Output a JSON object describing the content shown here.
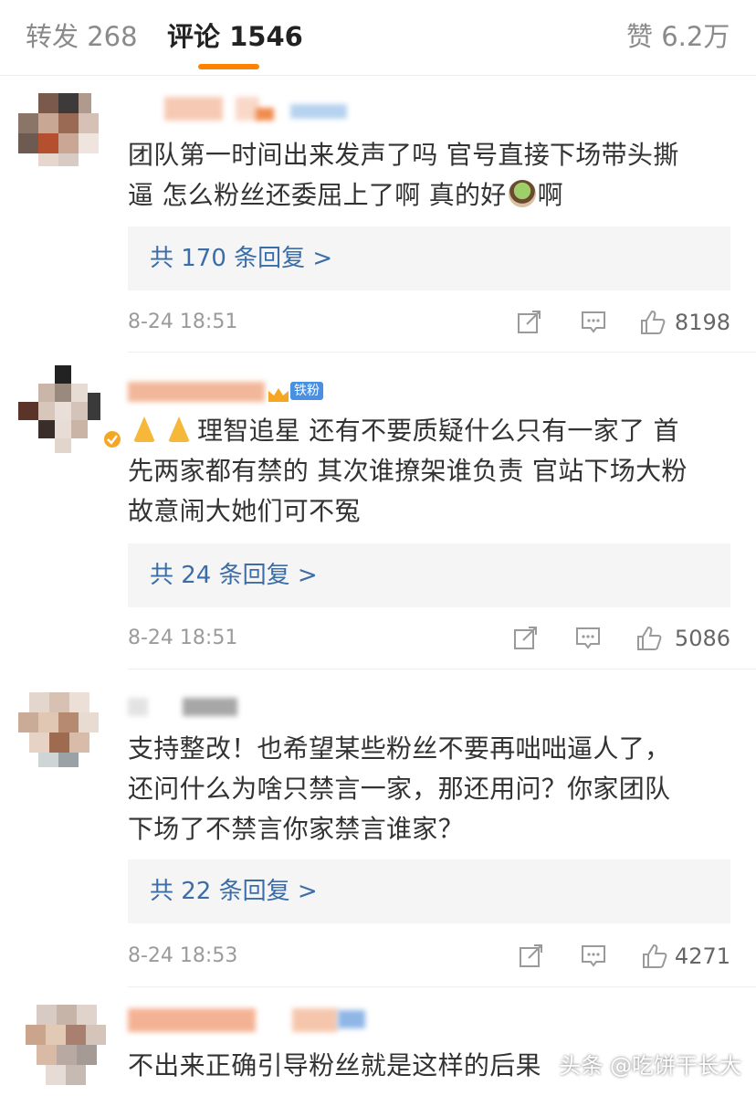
{
  "tabs": [
    {
      "label": "转发 268",
      "active": false
    },
    {
      "label": "评论 1546",
      "active": true
    },
    {
      "label": "赞 6.2万",
      "active": false
    }
  ],
  "accent_color": "#ff8200",
  "link_color": "#3b6da8",
  "comments": [
    {
      "text_line1": "团队第一时间出来发声了吗 官号直接下场带头撕",
      "text_line2_a": "逼 怎么粉丝还委屈上了啊 真的好",
      "text_line2_b": "啊",
      "emoji": "tea-cup-icon",
      "replies": "共 170 条回复 >",
      "time": "8-24 18:51",
      "likes": "8198"
    },
    {
      "badge": "铁粉",
      "text_line1": "理智追星 还有不要质疑什么只有一家了 首",
      "text_line2": "先两家都有禁的 其次谁撩架谁负责 官站下场大粉",
      "text_line3": "故意闹大她们可不冤",
      "emoji": "praying-hands-icon",
      "replies": "共 24 条回复 >",
      "time": "8-24 18:51",
      "likes": "5086"
    },
    {
      "text_line1": "支持整改！也希望某些粉丝不要再咄咄逼人了，",
      "text_line2": "还问什么为啥只禁言一家，那还用问？你家团队",
      "text_line3": "下场了不禁言你家禁言谁家？",
      "replies": "共 22 条回复 >",
      "time": "8-24 18:53",
      "likes": "4271"
    },
    {
      "text_line1": "不出来正确引导粉丝就是这样的后果"
    }
  ],
  "watermark": "头条 @吃饼干长大"
}
